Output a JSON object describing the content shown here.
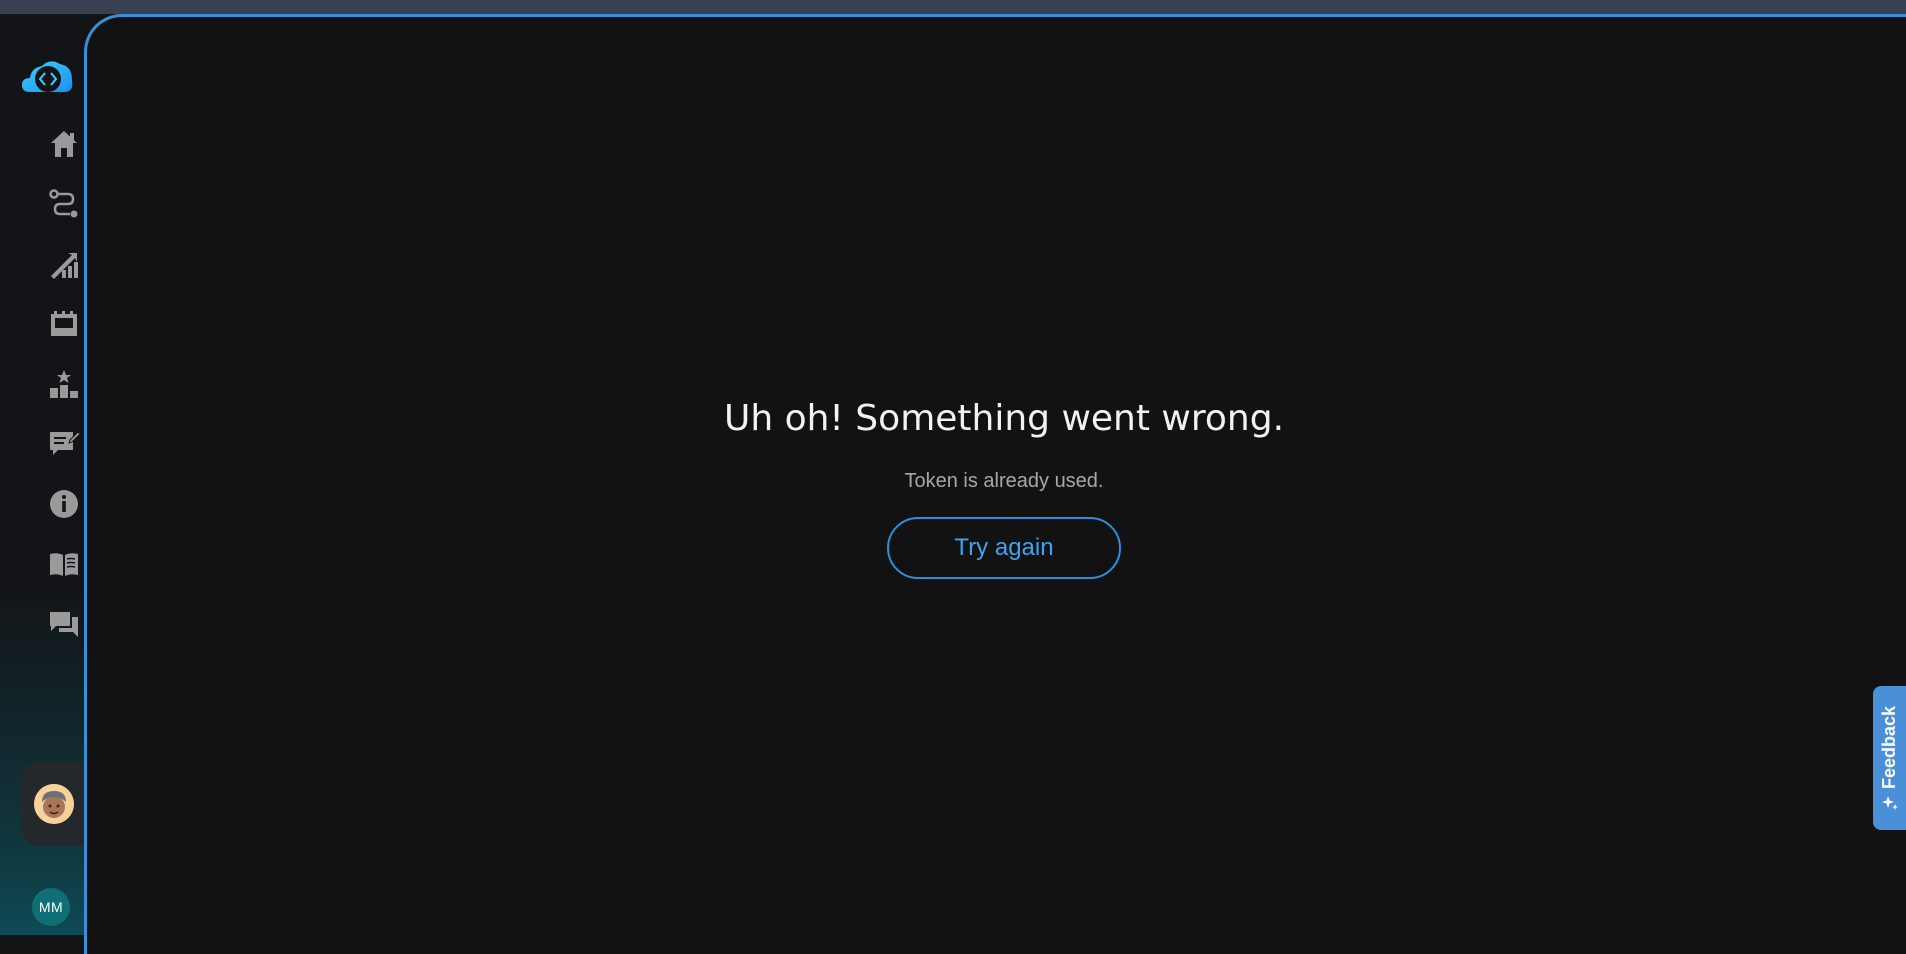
{
  "error": {
    "title": "Uh oh! Something went wrong.",
    "message": "Token is already used.",
    "retry_label": "Try again"
  },
  "user": {
    "initials": "MM"
  },
  "feedback": {
    "label": "Feedback"
  },
  "sidebar": {
    "items": [
      {
        "name": "home",
        "icon": "home-icon"
      },
      {
        "name": "routes",
        "icon": "route-icon"
      },
      {
        "name": "growth",
        "icon": "growth-chart-icon"
      },
      {
        "name": "board",
        "icon": "board-icon"
      },
      {
        "name": "leaderboard",
        "icon": "leaderboard-icon"
      },
      {
        "name": "posts",
        "icon": "edit-comment-icon"
      },
      {
        "name": "info",
        "icon": "info-icon"
      },
      {
        "name": "docs",
        "icon": "book-icon"
      },
      {
        "name": "chat",
        "icon": "chat-icon"
      }
    ]
  },
  "colors": {
    "accent": "#2b8fd9",
    "background": "#121212",
    "icon": "#9a9a9a"
  }
}
